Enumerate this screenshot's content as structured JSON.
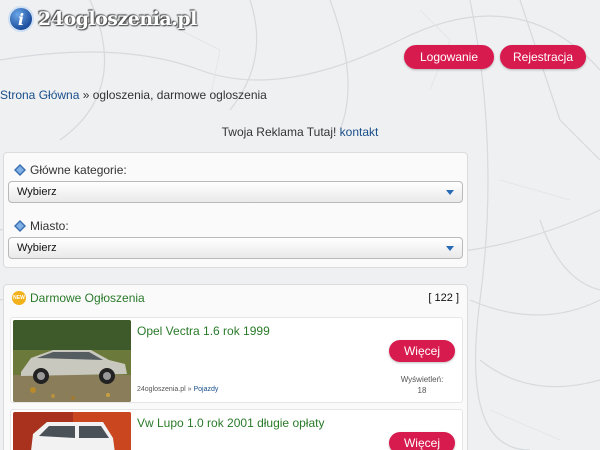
{
  "header": {
    "logo_text": "24ogloszenia.pl",
    "logo_icon": "info-icon",
    "login_label": "Logowanie",
    "register_label": "Rejestracja"
  },
  "breadcrumb": {
    "home": "Strona Główna",
    "separator": " » ",
    "current": "ogloszenia, darmowe ogloszenia"
  },
  "ad_banner": {
    "text": "Twoja Reklama Tutaj! ",
    "link": "kontakt"
  },
  "filters": {
    "category_label": "Główne kategorie:",
    "category_value": "Wybierz",
    "city_label": "Miasto:",
    "city_value": "Wybierz"
  },
  "listings": {
    "title": "Darmowe Ogłoszenia",
    "count": "[ 122 ]",
    "new_badge": "NEW",
    "items": [
      {
        "title": "Opel Vectra 1.6 rok 1999",
        "button": "Więcej",
        "site": "24ogloszenia.pl",
        "sep": " » ",
        "category": "Pojazdy",
        "views_label": "Wyświetleń:",
        "views": "18"
      },
      {
        "title": "Vw Lupo 1.0 rok 2001 długie opłaty",
        "button": "Więcej"
      }
    ]
  },
  "colors": {
    "accent_red": "#d81b4e",
    "link_blue": "#1a4f8a",
    "title_green": "#2a7a2a"
  }
}
